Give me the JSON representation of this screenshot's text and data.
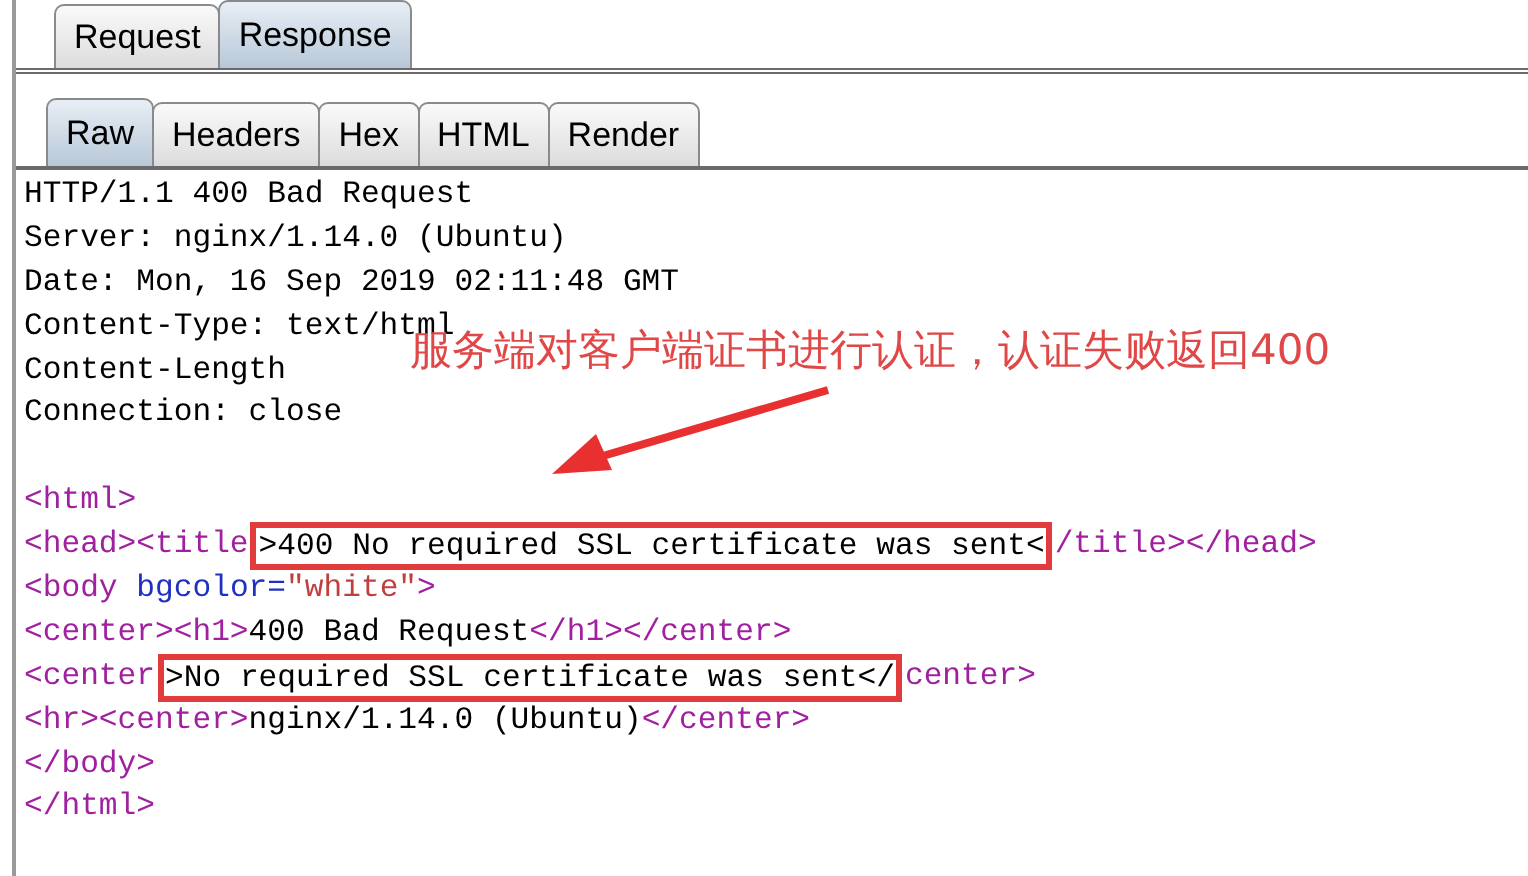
{
  "message_tabs": [
    {
      "label": "Request",
      "selected": false
    },
    {
      "label": "Response",
      "selected": true
    }
  ],
  "view_tabs": [
    {
      "label": "Raw",
      "selected": true
    },
    {
      "label": "Headers",
      "selected": false
    },
    {
      "label": "Hex",
      "selected": false
    },
    {
      "label": "HTML",
      "selected": false
    },
    {
      "label": "Render",
      "selected": false
    }
  ],
  "header_lines": [
    "HTTP/1.1 400 Bad Request",
    "Server: nginx/1.14.0 (Ubuntu)",
    "Date: Mon, 16 Sep 2019 02:11:48 GMT",
    "Content-Type: text/html",
    "Content-Length",
    "Connection: close"
  ],
  "body_lines": [
    [
      {
        "kind": "tag",
        "text": "<html>"
      }
    ],
    [
      {
        "kind": "tag",
        "text": "<head><title"
      },
      {
        "kind": "text",
        "text": ">400 No required SSL certificate was sent<",
        "boxed": true
      },
      {
        "kind": "tag",
        "text": "/title></head>"
      }
    ],
    [
      {
        "kind": "tag",
        "text": "<body "
      },
      {
        "kind": "attr",
        "text": "bgcolor="
      },
      {
        "kind": "value",
        "text": "\"white\""
      },
      {
        "kind": "tag",
        "text": ">"
      }
    ],
    [
      {
        "kind": "tag",
        "text": "<center><h1>"
      },
      {
        "kind": "text",
        "text": "400 Bad Request"
      },
      {
        "kind": "tag",
        "text": "</h1></center>"
      }
    ],
    [
      {
        "kind": "tag",
        "text": "<center"
      },
      {
        "kind": "text",
        "text": ">No required SSL certificate was sent</",
        "boxed": true
      },
      {
        "kind": "tag",
        "text": "center>"
      }
    ],
    [
      {
        "kind": "tag",
        "text": "<hr><center>"
      },
      {
        "kind": "text",
        "text": "nginx/1.14.0 (Ubuntu)"
      },
      {
        "kind": "tag",
        "text": "</center>"
      }
    ],
    [
      {
        "kind": "tag",
        "text": "</body>"
      }
    ],
    [
      {
        "kind": "tag",
        "text": "</html>"
      }
    ]
  ],
  "annotation": {
    "text": "服务端对客户端证书进行认证，认证失败返回400"
  }
}
